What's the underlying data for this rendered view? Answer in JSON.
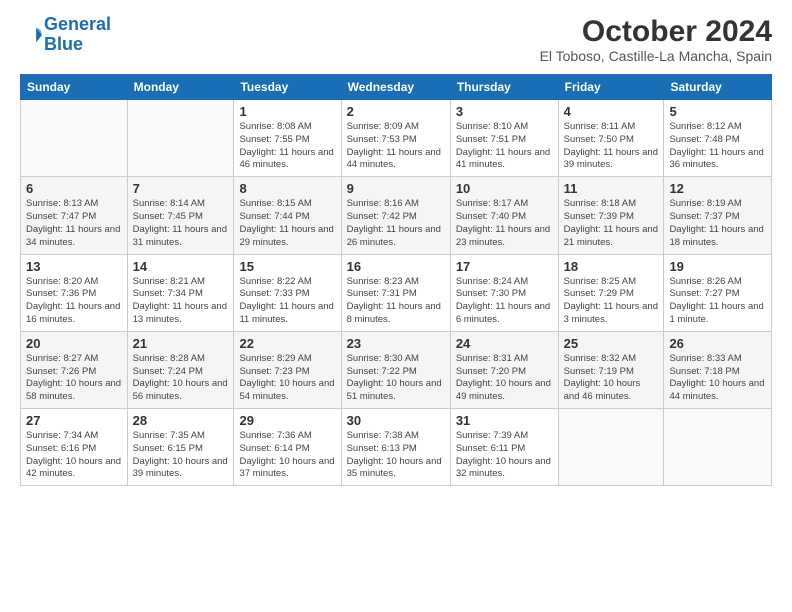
{
  "header": {
    "logo_line1": "General",
    "logo_line2": "Blue",
    "title": "October 2024",
    "subtitle": "El Toboso, Castille-La Mancha, Spain"
  },
  "days_header": [
    "Sunday",
    "Monday",
    "Tuesday",
    "Wednesday",
    "Thursday",
    "Friday",
    "Saturday"
  ],
  "weeks": [
    [
      {
        "day": "",
        "sunrise": "",
        "sunset": "",
        "daylight": ""
      },
      {
        "day": "",
        "sunrise": "",
        "sunset": "",
        "daylight": ""
      },
      {
        "day": "1",
        "sunrise": "Sunrise: 8:08 AM",
        "sunset": "Sunset: 7:55 PM",
        "daylight": "Daylight: 11 hours and 46 minutes."
      },
      {
        "day": "2",
        "sunrise": "Sunrise: 8:09 AM",
        "sunset": "Sunset: 7:53 PM",
        "daylight": "Daylight: 11 hours and 44 minutes."
      },
      {
        "day": "3",
        "sunrise": "Sunrise: 8:10 AM",
        "sunset": "Sunset: 7:51 PM",
        "daylight": "Daylight: 11 hours and 41 minutes."
      },
      {
        "day": "4",
        "sunrise": "Sunrise: 8:11 AM",
        "sunset": "Sunset: 7:50 PM",
        "daylight": "Daylight: 11 hours and 39 minutes."
      },
      {
        "day": "5",
        "sunrise": "Sunrise: 8:12 AM",
        "sunset": "Sunset: 7:48 PM",
        "daylight": "Daylight: 11 hours and 36 minutes."
      }
    ],
    [
      {
        "day": "6",
        "sunrise": "Sunrise: 8:13 AM",
        "sunset": "Sunset: 7:47 PM",
        "daylight": "Daylight: 11 hours and 34 minutes."
      },
      {
        "day": "7",
        "sunrise": "Sunrise: 8:14 AM",
        "sunset": "Sunset: 7:45 PM",
        "daylight": "Daylight: 11 hours and 31 minutes."
      },
      {
        "day": "8",
        "sunrise": "Sunrise: 8:15 AM",
        "sunset": "Sunset: 7:44 PM",
        "daylight": "Daylight: 11 hours and 29 minutes."
      },
      {
        "day": "9",
        "sunrise": "Sunrise: 8:16 AM",
        "sunset": "Sunset: 7:42 PM",
        "daylight": "Daylight: 11 hours and 26 minutes."
      },
      {
        "day": "10",
        "sunrise": "Sunrise: 8:17 AM",
        "sunset": "Sunset: 7:40 PM",
        "daylight": "Daylight: 11 hours and 23 minutes."
      },
      {
        "day": "11",
        "sunrise": "Sunrise: 8:18 AM",
        "sunset": "Sunset: 7:39 PM",
        "daylight": "Daylight: 11 hours and 21 minutes."
      },
      {
        "day": "12",
        "sunrise": "Sunrise: 8:19 AM",
        "sunset": "Sunset: 7:37 PM",
        "daylight": "Daylight: 11 hours and 18 minutes."
      }
    ],
    [
      {
        "day": "13",
        "sunrise": "Sunrise: 8:20 AM",
        "sunset": "Sunset: 7:36 PM",
        "daylight": "Daylight: 11 hours and 16 minutes."
      },
      {
        "day": "14",
        "sunrise": "Sunrise: 8:21 AM",
        "sunset": "Sunset: 7:34 PM",
        "daylight": "Daylight: 11 hours and 13 minutes."
      },
      {
        "day": "15",
        "sunrise": "Sunrise: 8:22 AM",
        "sunset": "Sunset: 7:33 PM",
        "daylight": "Daylight: 11 hours and 11 minutes."
      },
      {
        "day": "16",
        "sunrise": "Sunrise: 8:23 AM",
        "sunset": "Sunset: 7:31 PM",
        "daylight": "Daylight: 11 hours and 8 minutes."
      },
      {
        "day": "17",
        "sunrise": "Sunrise: 8:24 AM",
        "sunset": "Sunset: 7:30 PM",
        "daylight": "Daylight: 11 hours and 6 minutes."
      },
      {
        "day": "18",
        "sunrise": "Sunrise: 8:25 AM",
        "sunset": "Sunset: 7:29 PM",
        "daylight": "Daylight: 11 hours and 3 minutes."
      },
      {
        "day": "19",
        "sunrise": "Sunrise: 8:26 AM",
        "sunset": "Sunset: 7:27 PM",
        "daylight": "Daylight: 11 hours and 1 minute."
      }
    ],
    [
      {
        "day": "20",
        "sunrise": "Sunrise: 8:27 AM",
        "sunset": "Sunset: 7:26 PM",
        "daylight": "Daylight: 10 hours and 58 minutes."
      },
      {
        "day": "21",
        "sunrise": "Sunrise: 8:28 AM",
        "sunset": "Sunset: 7:24 PM",
        "daylight": "Daylight: 10 hours and 56 minutes."
      },
      {
        "day": "22",
        "sunrise": "Sunrise: 8:29 AM",
        "sunset": "Sunset: 7:23 PM",
        "daylight": "Daylight: 10 hours and 54 minutes."
      },
      {
        "day": "23",
        "sunrise": "Sunrise: 8:30 AM",
        "sunset": "Sunset: 7:22 PM",
        "daylight": "Daylight: 10 hours and 51 minutes."
      },
      {
        "day": "24",
        "sunrise": "Sunrise: 8:31 AM",
        "sunset": "Sunset: 7:20 PM",
        "daylight": "Daylight: 10 hours and 49 minutes."
      },
      {
        "day": "25",
        "sunrise": "Sunrise: 8:32 AM",
        "sunset": "Sunset: 7:19 PM",
        "daylight": "Daylight: 10 hours and 46 minutes."
      },
      {
        "day": "26",
        "sunrise": "Sunrise: 8:33 AM",
        "sunset": "Sunset: 7:18 PM",
        "daylight": "Daylight: 10 hours and 44 minutes."
      }
    ],
    [
      {
        "day": "27",
        "sunrise": "Sunrise: 7:34 AM",
        "sunset": "Sunset: 6:16 PM",
        "daylight": "Daylight: 10 hours and 42 minutes."
      },
      {
        "day": "28",
        "sunrise": "Sunrise: 7:35 AM",
        "sunset": "Sunset: 6:15 PM",
        "daylight": "Daylight: 10 hours and 39 minutes."
      },
      {
        "day": "29",
        "sunrise": "Sunrise: 7:36 AM",
        "sunset": "Sunset: 6:14 PM",
        "daylight": "Daylight: 10 hours and 37 minutes."
      },
      {
        "day": "30",
        "sunrise": "Sunrise: 7:38 AM",
        "sunset": "Sunset: 6:13 PM",
        "daylight": "Daylight: 10 hours and 35 minutes."
      },
      {
        "day": "31",
        "sunrise": "Sunrise: 7:39 AM",
        "sunset": "Sunset: 6:11 PM",
        "daylight": "Daylight: 10 hours and 32 minutes."
      },
      {
        "day": "",
        "sunrise": "",
        "sunset": "",
        "daylight": ""
      },
      {
        "day": "",
        "sunrise": "",
        "sunset": "",
        "daylight": ""
      }
    ]
  ]
}
